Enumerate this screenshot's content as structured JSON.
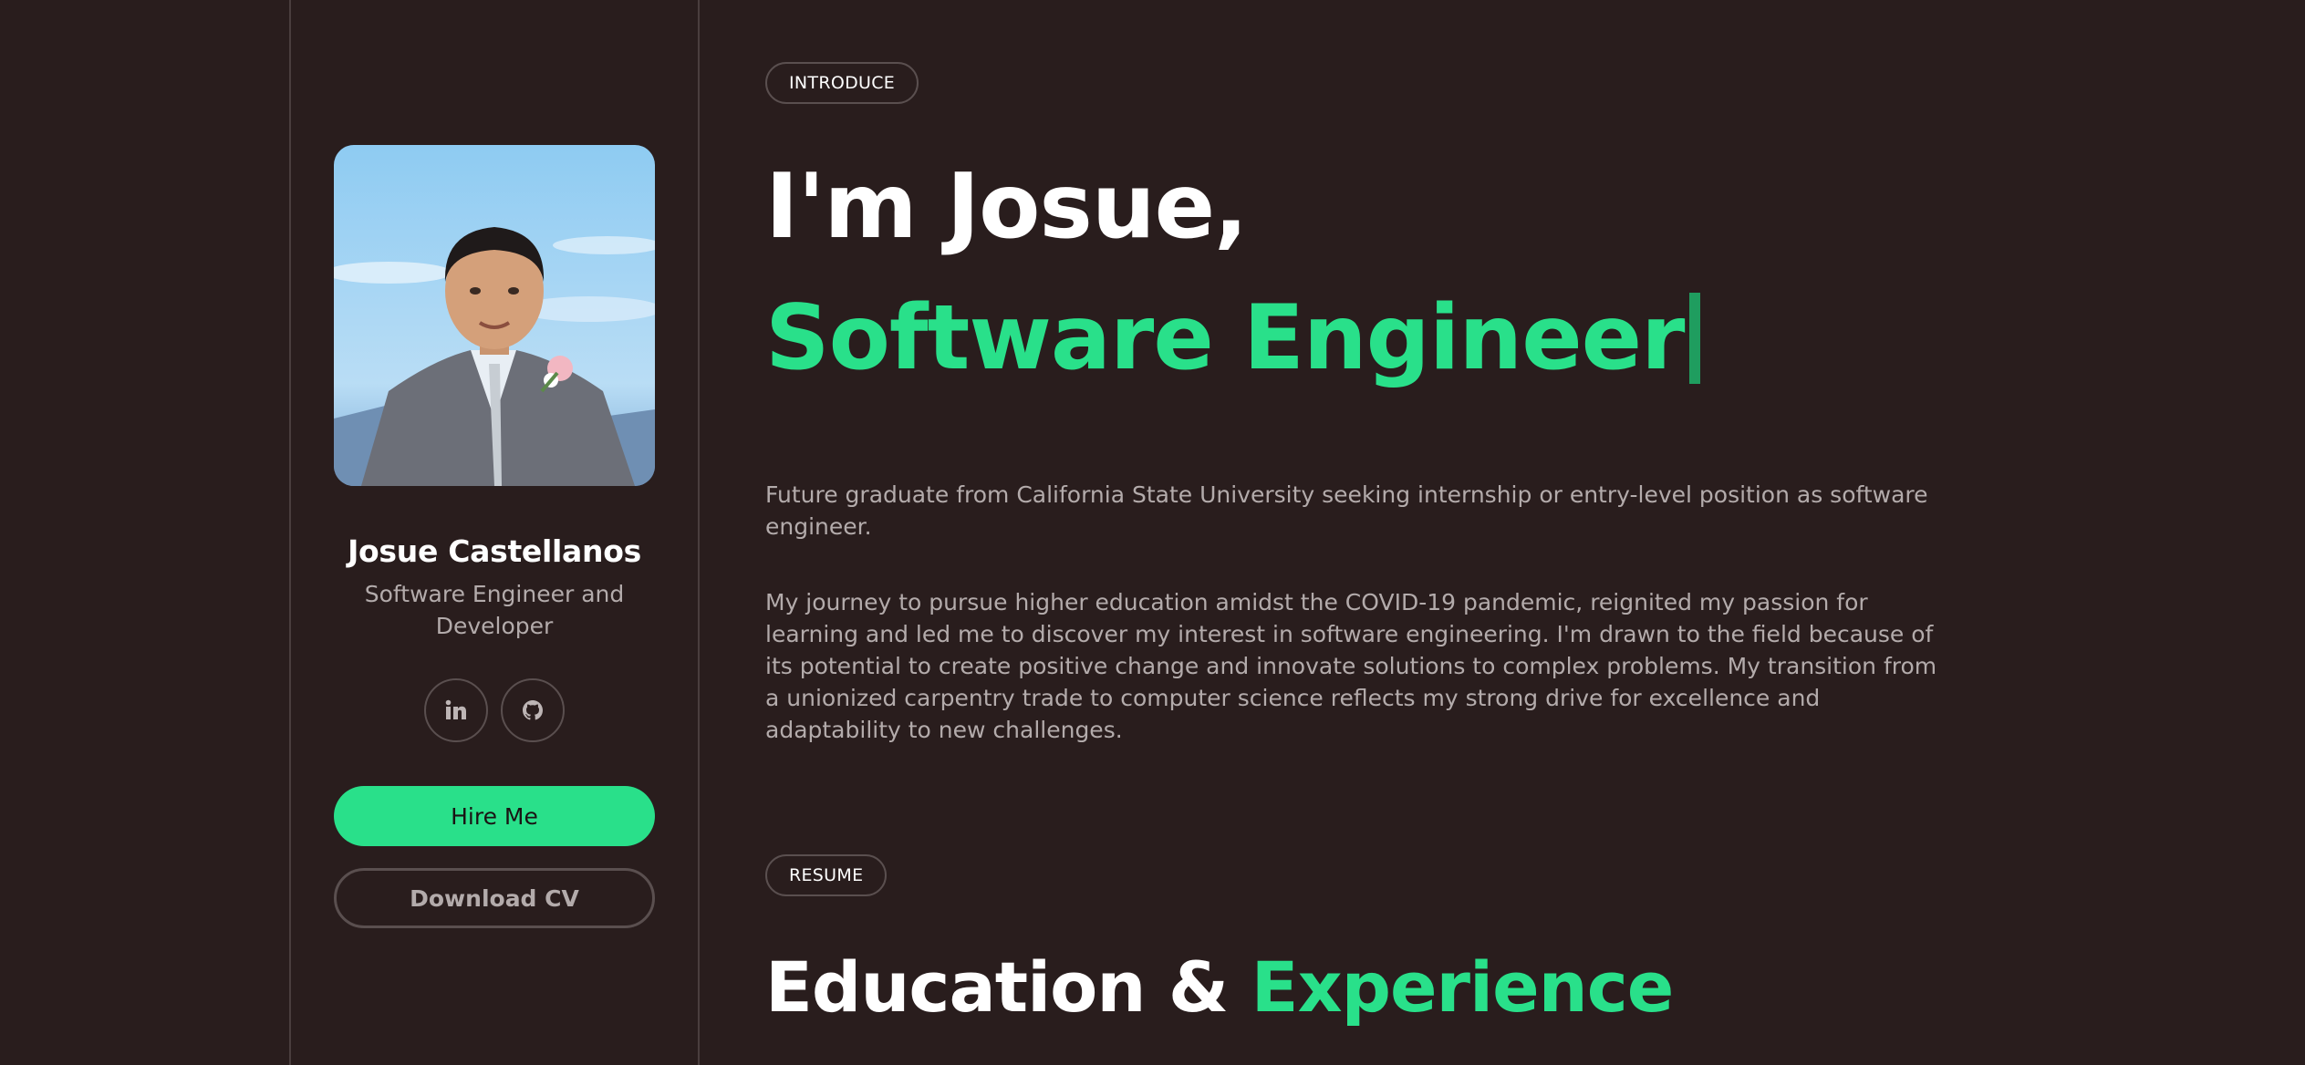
{
  "sidebar": {
    "name": "Josue Castellanos",
    "role": "Software Engineer and Developer",
    "social": [
      {
        "icon": "linkedin-icon",
        "label": "in"
      },
      {
        "icon": "github-icon"
      }
    ],
    "hire_label": "Hire Me",
    "cv_label": "Download CV"
  },
  "intro": {
    "pill": "INTRODUCE",
    "greeting": "I'm Josue,",
    "title": "Software Engineer",
    "summary": "Future graduate from California State University seeking internship or entry-level position as software engineer.",
    "story": "My journey to pursue higher education amidst the COVID-19 pandemic, reignited my passion for learning and led me to discover my interest in software engineering. I'm drawn to the field because of its potential to create positive change and innovate solutions to complex problems. My transition from a unionized carpentry trade to computer science reflects my strong drive for excellence and adaptability to new challenges."
  },
  "resume": {
    "pill": "RESUME",
    "heading_white": "Education & ",
    "heading_green": "Experience"
  },
  "colors": {
    "background": "#291d1d",
    "accent": "#29e08a",
    "muted_text": "#b3abab",
    "border": "#5a4f4f"
  }
}
